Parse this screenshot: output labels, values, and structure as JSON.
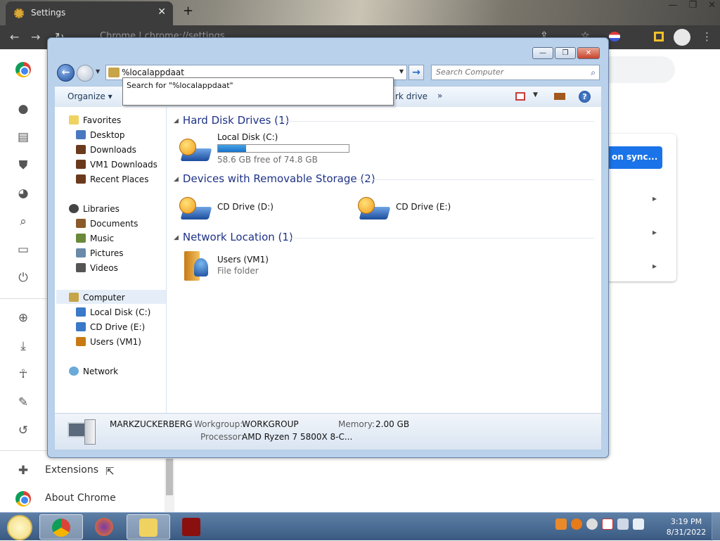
{
  "chrome": {
    "tab_title": "Settings",
    "tab_close": "✕",
    "new_tab": "+",
    "url_text": "Chrome | chrome://settings",
    "window_controls": [
      "—",
      "❐",
      "✕"
    ],
    "side_links": [
      "Extensions",
      "About Chrome"
    ],
    "sync_button": "on sync...",
    "icons": [
      "back-icon",
      "forward-icon",
      "reload-icon",
      "share-icon",
      "star-icon",
      "flag-icon",
      "sidepanel-icon",
      "profile-icon",
      "menu-icon"
    ]
  },
  "explorer": {
    "window_buttons": [
      "—",
      "❐",
      "✕"
    ],
    "address_value": "%localappdaat",
    "search_placeholder": "Search Computer",
    "suggestion": "Search for \"%localappdaat\"",
    "organize_label": "Organize ▾",
    "map_network_label": "rk drive",
    "more_label": "»",
    "nav": {
      "favorites_header": "Favorites",
      "favorites": [
        "Desktop",
        "Downloads",
        "VM1 Downloads",
        "Recent Places"
      ],
      "libraries_header": "Libraries",
      "libraries": [
        "Documents",
        "Music",
        "Pictures",
        "Videos"
      ],
      "computer_header": "Computer",
      "computer_items": [
        "Local Disk (C:)",
        "CD Drive (E:)",
        "Users (VM1)"
      ],
      "network_header": "Network"
    },
    "groups": {
      "hdd": "Hard Disk Drives (1)",
      "removable": "Devices with Removable Storage (2)",
      "network": "Network Location (1)"
    },
    "local_disk": {
      "name": "Local Disk (C:)",
      "free_text": "58.6 GB free of 74.8 GB",
      "used_fraction": 0.217
    },
    "cd_d": "CD Drive (D:)",
    "cd_e": "CD Drive (E:)",
    "users": {
      "name": "Users (VM1)",
      "type": "File folder"
    },
    "details": {
      "computer_name": "MARKZUCKERBERG",
      "workgroup_label": "Workgroup:",
      "workgroup_value": "WORKGROUP",
      "memory_label": "Memory:",
      "memory_value": "2.00 GB",
      "processor_label": "Processor:",
      "processor_value": "AMD Ryzen 7 5800X 8-C..."
    }
  },
  "taskbar": {
    "time": "3:19 PM",
    "date": "8/31/2022",
    "apps": [
      "chrome",
      "firefox",
      "explorer",
      "flash"
    ]
  }
}
